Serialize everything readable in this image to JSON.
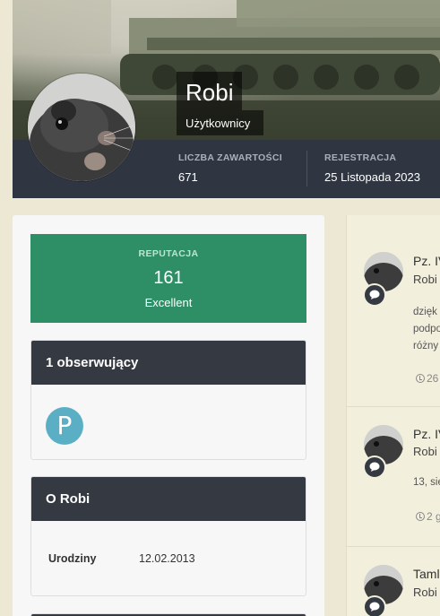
{
  "profile": {
    "name": "Robi",
    "group": "Użytkownicy",
    "stats": [
      {
        "label": "Liczba zawartości",
        "value": "671"
      },
      {
        "label": "Rejestracja",
        "value": "25 Listopada 2023"
      }
    ]
  },
  "reputation": {
    "label": "Reputacja",
    "value": "161",
    "description": "Excellent",
    "color": "#2e8f66"
  },
  "followers": {
    "title": "1 obserwujący",
    "items": [
      {
        "initial": "P",
        "color": "#5aafc4"
      }
    ]
  },
  "about": {
    "title": "O Robi",
    "fields": [
      {
        "label": "Urodziny",
        "value": "12.02.2013"
      }
    ]
  },
  "feed": {
    "items": [
      {
        "title": "Pz. IV",
        "author": "Robi",
        "lines": [
          "dzięk",
          "podpo",
          "różny"
        ],
        "time": "26"
      },
      {
        "title": "Pz. IV",
        "author": "Robi",
        "lines": [
          "13, sie"
        ],
        "time": "2 g"
      },
      {
        "title": "Taml",
        "author": "Robi"
      }
    ],
    "badge_icon": "comment-icon",
    "time_icon": "clock-icon"
  },
  "colors": {
    "page_background": "#ece8d3",
    "header_bar": "#2f3641",
    "widget_header": "#353a42"
  }
}
